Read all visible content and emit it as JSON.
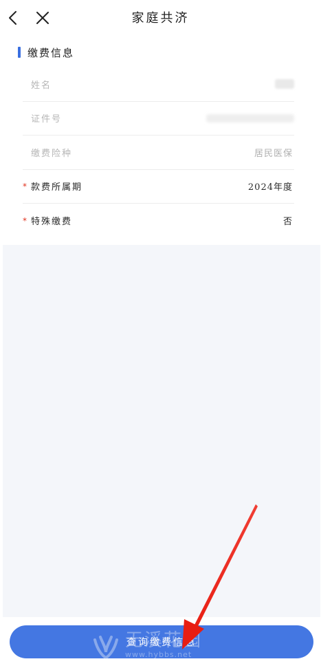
{
  "header": {
    "title": "家庭共济",
    "back_icon": "chevron-left-icon",
    "close_icon": "close-icon"
  },
  "section": {
    "title": "缴费信息",
    "accent_color": "#3a6fe0"
  },
  "form": {
    "rows": [
      {
        "label": "姓名",
        "value": "",
        "required": false,
        "redacted": true
      },
      {
        "label": "证件号",
        "value": "",
        "required": false,
        "redacted": true
      },
      {
        "label": "缴费险种",
        "value": "居民医保",
        "required": false
      },
      {
        "label": "款费所属期",
        "value": "2024年度",
        "required": true
      },
      {
        "label": "特殊缴费",
        "value": "否",
        "required": true
      }
    ],
    "required_mark": "*",
    "required_color": "#e0321e"
  },
  "actions": {
    "query_label": "查询缴费信息",
    "button_color": "#4477e2"
  },
  "annotation": {
    "arrow_color": "#f02a1e"
  },
  "watermark": {
    "text": "无溪花园",
    "url": "www.hybbs.net"
  }
}
